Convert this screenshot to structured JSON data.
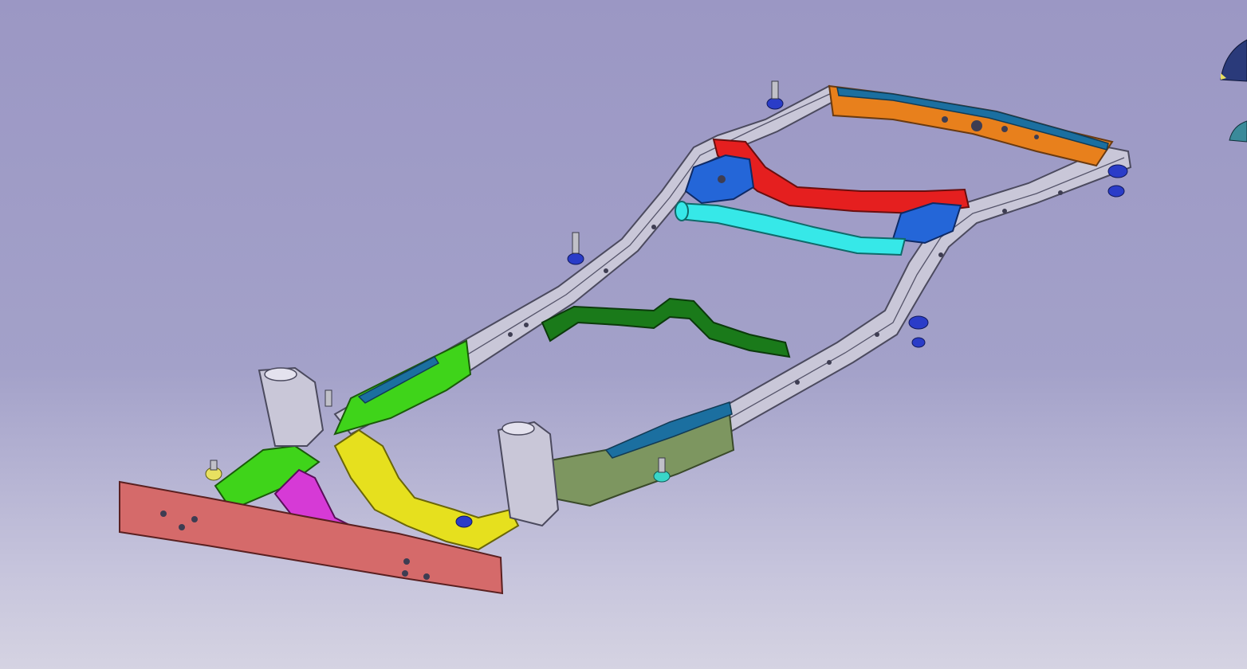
{
  "scene": {
    "background_top": "#9b97c4",
    "background_bottom": "#d5d3e2",
    "frame_color": "#c9c7d8"
  },
  "parts": [
    {
      "id": "front-bumper-beam",
      "color": "#d56a6a"
    },
    {
      "id": "front-crossmember-magenta",
      "color": "#d63ad6"
    },
    {
      "id": "front-crossmember-yellow",
      "color": "#e6e01e"
    },
    {
      "id": "front-rail-left-green",
      "color": "#3fd41a"
    },
    {
      "id": "rail-reinforcement-teal",
      "color": "#1b6fa0"
    },
    {
      "id": "mid-rail-olive",
      "color": "#7d9660"
    },
    {
      "id": "crossmember-dark-green",
      "color": "#1a7a1a"
    },
    {
      "id": "crossmember-cyan",
      "color": "#36e8e8"
    },
    {
      "id": "crossmember-red",
      "color": "#e51f1f"
    },
    {
      "id": "gusset-blue",
      "color": "#2466d8"
    },
    {
      "id": "rear-crossmember-orange",
      "color": "#e8801c"
    },
    {
      "id": "body-mount-pads",
      "color": "#2a3cc8"
    },
    {
      "id": "body-mount-pads-yellow",
      "color": "#e8e060"
    },
    {
      "id": "body-mount-pads-teal",
      "color": "#3ad6c8"
    }
  ],
  "compass": {
    "icon": "compass-icon"
  }
}
